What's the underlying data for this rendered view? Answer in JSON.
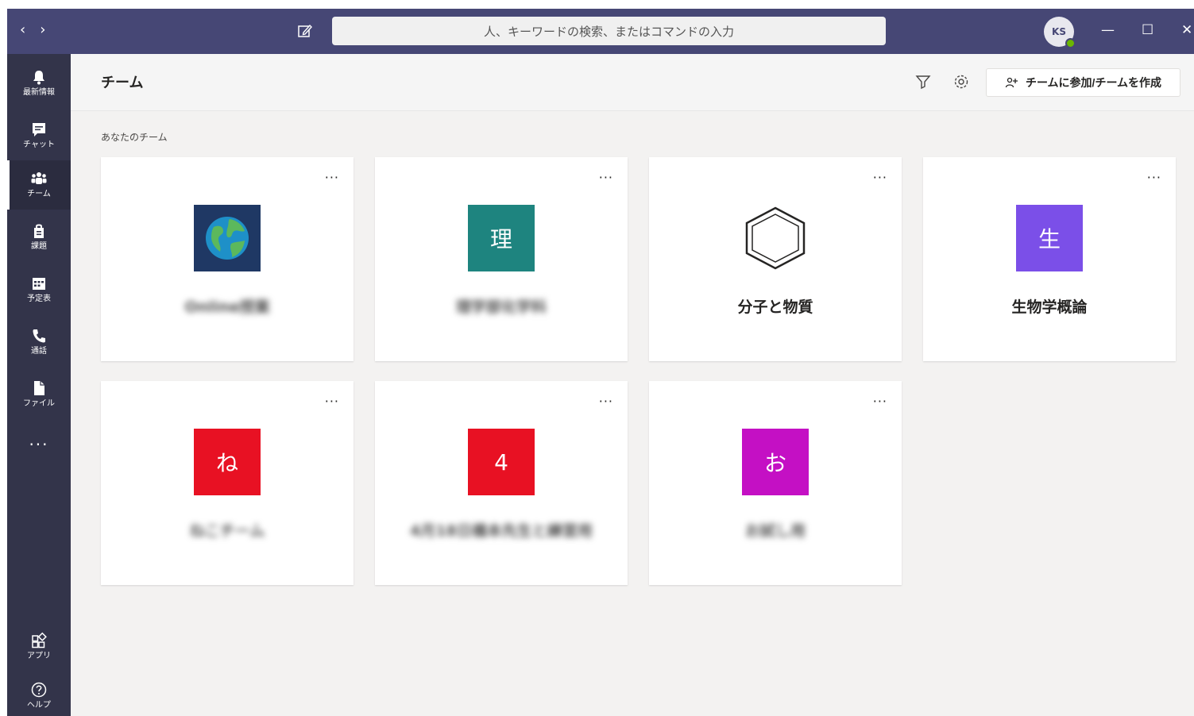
{
  "titlebar": {
    "back_label": "‹",
    "forward_label": "›",
    "search_placeholder": "人、キーワードの検索、またはコマンドの入力",
    "avatar_initials": "KS",
    "minimize_label": "—",
    "maximize_label": "☐",
    "close_label": "✕"
  },
  "rail": {
    "items": [
      {
        "label": "最新情報",
        "icon": "bell-icon"
      },
      {
        "label": "チャット",
        "icon": "chat-icon"
      },
      {
        "label": "チーム",
        "icon": "teams-icon"
      },
      {
        "label": "課題",
        "icon": "assignments-icon"
      },
      {
        "label": "予定表",
        "icon": "calendar-icon"
      },
      {
        "label": "通話",
        "icon": "phone-icon"
      },
      {
        "label": "ファイル",
        "icon": "file-icon"
      }
    ],
    "more_label": "···",
    "apps_label": "アプリ",
    "help_label": "ヘルプ",
    "active_index": 2
  },
  "header": {
    "title": "チーム",
    "join_button_label": "チームに参加/チームを作成"
  },
  "section_label": "あなたのチーム",
  "teams": [
    {
      "name": "Online授業",
      "logo": "globe-icon",
      "logo_text": "",
      "color": "#1f3864",
      "blurred": true
    },
    {
      "name": "理学部化学科",
      "logo": "letter",
      "logo_text": "理",
      "color": "#1e847f",
      "blurred": true
    },
    {
      "name": "分子と物質",
      "logo": "hexagon-icon",
      "logo_text": "",
      "color": "#ffffff",
      "blurred": false
    },
    {
      "name": "生物学概論",
      "logo": "letter",
      "logo_text": "生",
      "color": "#7b4fe8",
      "blurred": false
    },
    {
      "name": "ねこチーム",
      "logo": "letter",
      "logo_text": "ね",
      "color": "#e81123",
      "blurred": true
    },
    {
      "name": "4月18日橋本先生と練習用",
      "logo": "letter",
      "logo_text": "4",
      "color": "#e81123",
      "blurred": true
    },
    {
      "name": "お試し用",
      "logo": "letter",
      "logo_text": "お",
      "color": "#c410c4",
      "blurred": true
    }
  ],
  "card_more_label": "···"
}
